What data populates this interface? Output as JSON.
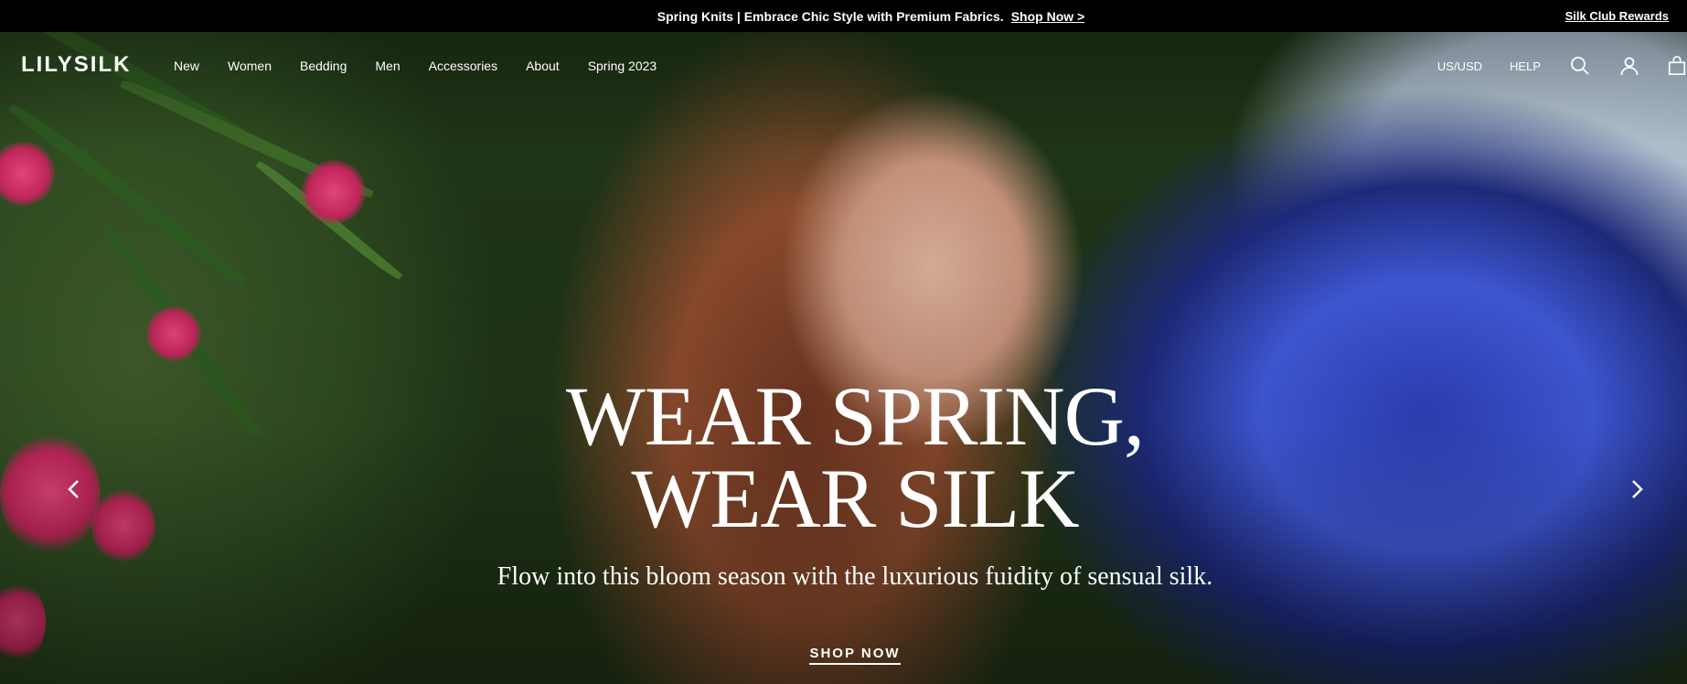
{
  "announcement": {
    "message": "Spring Knits | Embrace Chic Style with Premium Fabrics.",
    "shop_link": "Shop Now >",
    "rewards_link": "Silk Club Rewards"
  },
  "nav": {
    "logo": "LILYSILK",
    "links": [
      "New",
      "Women",
      "Bedding",
      "Men",
      "Accessories",
      "About",
      "Spring 2023"
    ],
    "region": "US/USD",
    "help": "HELP",
    "icons": [
      "search-icon",
      "account-icon",
      "cart-icon"
    ]
  },
  "hero": {
    "headline_line1": "WEAR SPRING,",
    "headline_line2": "WEAR SILK",
    "subline": "Flow into this bloom season with the luxurious fuidity of sensual silk.",
    "cta": "SHOP NOW"
  },
  "colors": {
    "bar": "#000000",
    "text": "#ffffff",
    "silk_blue": "#3f58d6"
  }
}
